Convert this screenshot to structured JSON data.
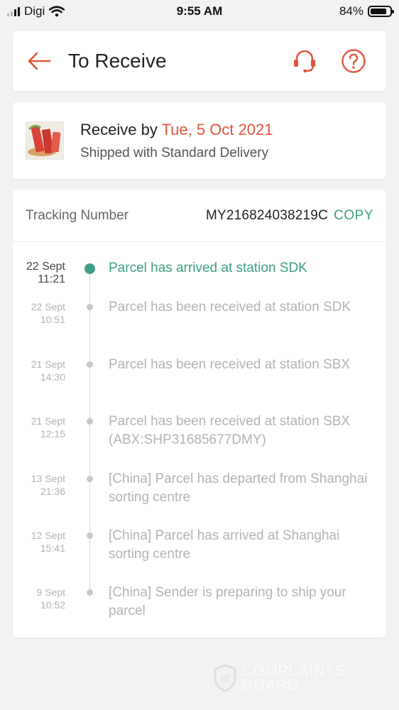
{
  "status_bar": {
    "carrier": "Digi",
    "time": "9:55 AM",
    "battery": "84%"
  },
  "header": {
    "title": "To Receive"
  },
  "delivery": {
    "receive_by_label": "Receive by",
    "receive_by_date": "Tue, 5 Oct 2021",
    "shipping_method": "Shipped with Standard Delivery"
  },
  "tracking": {
    "label": "Tracking Number",
    "number": "MY216824038219C",
    "copy_label": "COPY",
    "events": [
      {
        "date": "22 Sept",
        "time": "11:21",
        "text": "Parcel has arrived at station SDK"
      },
      {
        "date": "22 Sept",
        "time": "10:51",
        "text": "Parcel has been received at station SDK"
      },
      {
        "date": "21 Sept",
        "time": "14:30",
        "text": "Parcel has been received at station SBX"
      },
      {
        "date": "21 Sept",
        "time": "12:15",
        "text": "Parcel has been received at station SBX (ABX:SHP31685677DMY)"
      },
      {
        "date": "13 Sept",
        "time": "21:36",
        "text": "[China] Parcel has departed from Shanghai sorting centre"
      },
      {
        "date": "12 Sept",
        "time": "15:41",
        "text": "[China] Parcel has arrived at Shanghai sorting centre"
      },
      {
        "date": "9 Sept",
        "time": "10:52",
        "text": "[China] Sender is preparing to ship your parcel"
      }
    ]
  },
  "watermark": {
    "line1": "COMPLAINTS",
    "line2": "BOARD"
  },
  "colors": {
    "accent": "#e0553a",
    "success": "#3f9f86"
  }
}
